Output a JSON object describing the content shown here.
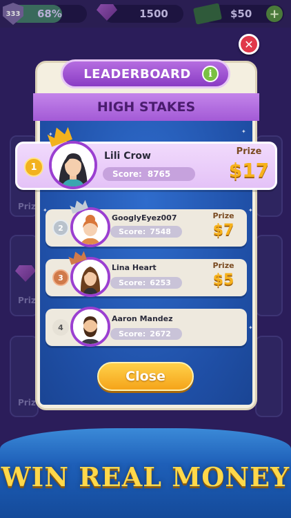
{
  "top_bar": {
    "level": "333",
    "xp_percent": "68%",
    "xp_fraction": 0.68,
    "gems": "1500",
    "cash": "$50"
  },
  "background_prize_label": "Priz",
  "modal": {
    "title": "LEADERBOARD",
    "subtitle": "HIGH STAKES",
    "prize_label": "Prize",
    "score_label": "Score:",
    "close_label": "Close",
    "players": [
      {
        "rank": "1",
        "name": "Lili Crow",
        "score": "8765",
        "prize": "$17"
      },
      {
        "rank": "2",
        "name": "GooglyEyez007",
        "score": "7548",
        "prize": "$7"
      },
      {
        "rank": "3",
        "name": "Lina Heart",
        "score": "6253",
        "prize": "$5"
      },
      {
        "rank": "4",
        "name": "Aaron Mandez",
        "score": "2672",
        "prize": ""
      }
    ]
  },
  "banner_text": "WIN REAL MONEY",
  "colors": {
    "gold": "#f7b21c",
    "silver": "#b9c2cc",
    "bronze": "#d07a4a",
    "purple": "#9b3fd1",
    "close_red": "#e0384a",
    "banner_yellow": "#ffd84a"
  },
  "icons": [
    "level-shield-icon",
    "gem-icon",
    "cash-icon",
    "plus-icon",
    "close-icon",
    "info-icon",
    "crown-icon"
  ]
}
